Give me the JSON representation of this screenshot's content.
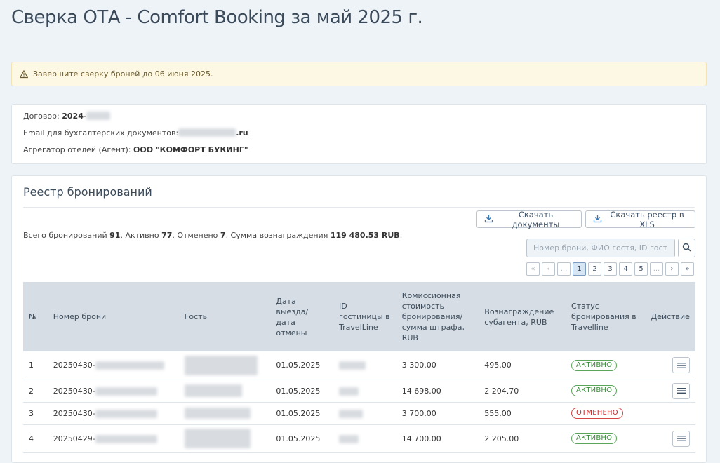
{
  "header": {
    "title": "Сверка ОТА - Comfort Booking за май 2025 г."
  },
  "alert": {
    "text": "Завершите сверку броней до 06 июня 2025."
  },
  "contract": {
    "contract_label": "Договор:",
    "contract_value": "2024-",
    "email_label": "Email для бухгалтерских документов:",
    "email_suffix": ".ru",
    "agent_label": "Агрегатор отелей (Агент):",
    "agent_value": "ООО \"КОМФОРТ БУКИНГ\""
  },
  "registry": {
    "title": "Реестр бронирований",
    "download_docs_label": "Скачать документы",
    "download_xls_label": "Скачать реестр в XLS",
    "summary": {
      "total_label": "Всего бронирований",
      "total": "91",
      "active_label": ". Активно",
      "active": "77",
      "cancelled_label": ". Отменено",
      "cancelled": "7",
      "sum_label": ". Сумма вознаграждения",
      "sum": "119 480.53 RUB",
      "end": "."
    },
    "search_placeholder": "Номер брони, ФИО гостя, ID гостиницы",
    "pager": [
      "«",
      "‹",
      "...",
      "1",
      "2",
      "3",
      "4",
      "5",
      "...",
      "›",
      "»"
    ],
    "columns": {
      "num": "№",
      "booking": "Номер брони",
      "guest": "Гость",
      "date": "Дата выезда/ дата отмены",
      "hotel_id": "ID гостиницы в TravelLine",
      "commission": "Комиссионная стоимость бронирования/ сумма штрафа, RUB",
      "reward": "Вознаграждение субагента, RUB",
      "status": "Статус бронирования в Travelline",
      "action": "Действие"
    },
    "rows": [
      {
        "num": "1",
        "booking": "20250430-",
        "date": "01.05.2025",
        "commission": "3 300.00",
        "reward": "495.00",
        "status": "АКТИВНО"
      },
      {
        "num": "2",
        "booking": "20250430-",
        "date": "01.05.2025",
        "commission": "14 698.00",
        "reward": "2 204.70",
        "status": "АКТИВНО"
      },
      {
        "num": "3",
        "booking": "20250430-",
        "date": "01.05.2025",
        "commission": "3 700.00",
        "reward": "555.00",
        "status": "ОТМЕНЕНО"
      },
      {
        "num": "4",
        "booking": "20250429-",
        "date": "01.05.2025",
        "commission": "14 700.00",
        "reward": "2 205.00",
        "status": "АКТИВНО"
      }
    ]
  },
  "colors": {
    "accent": "#3c5066",
    "active": "#3a8d3a",
    "cancelled": "#c62828",
    "alert_bg": "#fcf8e3"
  },
  "icons": {
    "warning": "warning-icon",
    "download": "download-icon",
    "search": "search-icon",
    "menu": "menu-icon"
  }
}
